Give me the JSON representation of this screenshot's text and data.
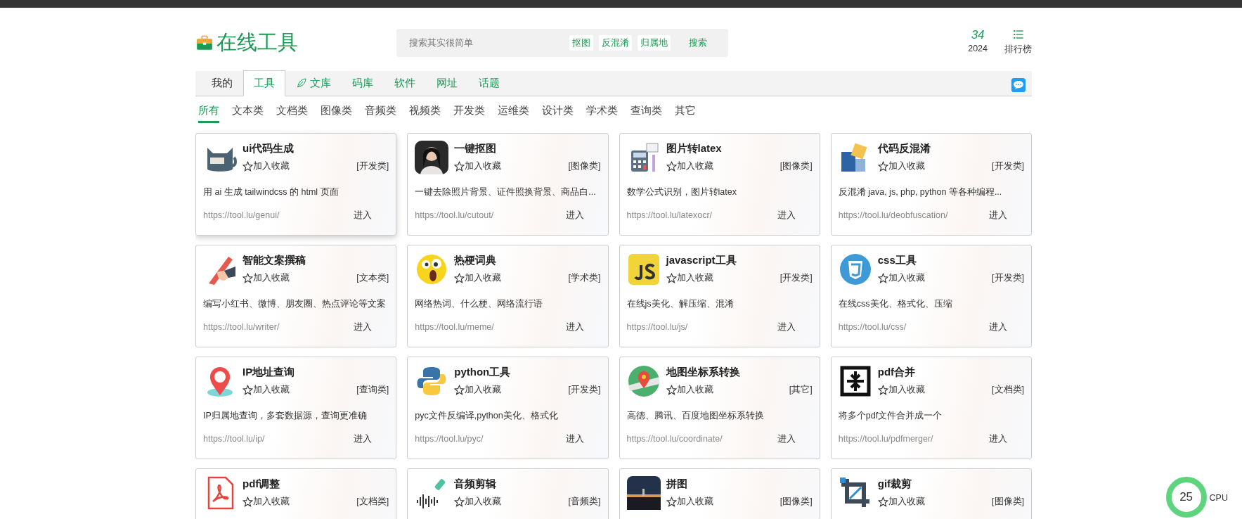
{
  "logo": {
    "text": "在线工具"
  },
  "search": {
    "placeholder": "搜索其实很简单",
    "chips": [
      "抠图",
      "反混淆",
      "归属地"
    ],
    "button": "搜索"
  },
  "counter": {
    "value": "34",
    "year": "2024"
  },
  "ranking": {
    "label": "排行榜"
  },
  "tabs": [
    {
      "label": "我的",
      "selected": false,
      "kind": "plain"
    },
    {
      "label": "工具",
      "selected": true,
      "kind": "link"
    },
    {
      "label": "文库",
      "selected": false,
      "kind": "leaf"
    },
    {
      "label": "码库",
      "selected": false,
      "kind": "link"
    },
    {
      "label": "软件",
      "selected": false,
      "kind": "link"
    },
    {
      "label": "网址",
      "selected": false,
      "kind": "link"
    },
    {
      "label": "话题",
      "selected": false,
      "kind": "link"
    }
  ],
  "categories": [
    {
      "label": "所有",
      "selected": true
    },
    {
      "label": "文本类",
      "selected": false
    },
    {
      "label": "文档类",
      "selected": false
    },
    {
      "label": "图像类",
      "selected": false
    },
    {
      "label": "音频类",
      "selected": false
    },
    {
      "label": "视频类",
      "selected": false
    },
    {
      "label": "开发类",
      "selected": false
    },
    {
      "label": "运维类",
      "selected": false
    },
    {
      "label": "设计类",
      "selected": false
    },
    {
      "label": "学术类",
      "selected": false
    },
    {
      "label": "查询类",
      "selected": false
    },
    {
      "label": "其它",
      "selected": false
    }
  ],
  "cards": [
    {
      "title": "ui代码生成",
      "favorite": "加入收藏",
      "category": "[开发类]",
      "description": "用 ai 生成 tailwindcss 的 html 页面",
      "url": "https://tool.lu/genui/",
      "enter": "进入",
      "hovered": true
    },
    {
      "title": "一键抠图",
      "favorite": "加入收藏",
      "category": "[图像类]",
      "description": "一键去除照片背景、证件照换背景、商品白...",
      "url": "https://tool.lu/cutout/",
      "enter": "进入",
      "hovered": false
    },
    {
      "title": "图片转latex",
      "favorite": "加入收藏",
      "category": "[图像类]",
      "description": "数学公式识别，图片转latex",
      "url": "https://tool.lu/latexocr/",
      "enter": "进入",
      "hovered": false
    },
    {
      "title": "代码反混淆",
      "favorite": "加入收藏",
      "category": "[开发类]",
      "description": "反混淆 java, js, php, python 等各种编程...",
      "url": "https://tool.lu/deobfuscation/",
      "enter": "进入",
      "hovered": false
    },
    {
      "title": "智能文案撰稿",
      "favorite": "加入收藏",
      "category": "[文本类]",
      "description": "编写小红书、微博、朋友圈、热点评论等文案",
      "url": "https://tool.lu/writer/",
      "enter": "进入",
      "hovered": false
    },
    {
      "title": "热梗词典",
      "favorite": "加入收藏",
      "category": "[学术类]",
      "description": "网络热词、什么梗、网络流行语",
      "url": "https://tool.lu/meme/",
      "enter": "进入",
      "hovered": false
    },
    {
      "title": "javascript工具",
      "favorite": "加入收藏",
      "category": "[开发类]",
      "description": "在线js美化、解压缩、混淆",
      "url": "https://tool.lu/js/",
      "enter": "进入",
      "hovered": false
    },
    {
      "title": "css工具",
      "favorite": "加入收藏",
      "category": "[开发类]",
      "description": "在线css美化、格式化、压缩",
      "url": "https://tool.lu/css/",
      "enter": "进入",
      "hovered": false
    },
    {
      "title": "IP地址查询",
      "favorite": "加入收藏",
      "category": "[查询类]",
      "description": "IP归属地查询，多套数据源，查询更准确",
      "url": "https://tool.lu/ip/",
      "enter": "进入",
      "hovered": false
    },
    {
      "title": "python工具",
      "favorite": "加入收藏",
      "category": "[开发类]",
      "description": "pyc文件反编译,python美化、格式化",
      "url": "https://tool.lu/pyc/",
      "enter": "进入",
      "hovered": false
    },
    {
      "title": "地图坐标系转换",
      "favorite": "加入收藏",
      "category": "[其它]",
      "description": "高德、腾讯、百度地图坐标系转换",
      "url": "https://tool.lu/coordinate/",
      "enter": "进入",
      "hovered": false
    },
    {
      "title": "pdf合并",
      "favorite": "加入收藏",
      "category": "[文档类]",
      "description": "将多个pdf文件合并成一个",
      "url": "https://tool.lu/pdfmerger/",
      "enter": "进入",
      "hovered": false
    },
    {
      "title": "pdf调整",
      "favorite": "加入收藏",
      "category": "[文档类]",
      "hovered": false
    },
    {
      "title": "音频剪辑",
      "favorite": "加入收藏",
      "category": "[音频类]",
      "hovered": false
    },
    {
      "title": "拼图",
      "favorite": "加入收藏",
      "category": "[图像类]",
      "hovered": false
    },
    {
      "title": "gif裁剪",
      "favorite": "加入收藏",
      "category": "[图像类]",
      "hovered": false
    }
  ],
  "cpu_widget": {
    "value": "25",
    "label": "CPU"
  }
}
